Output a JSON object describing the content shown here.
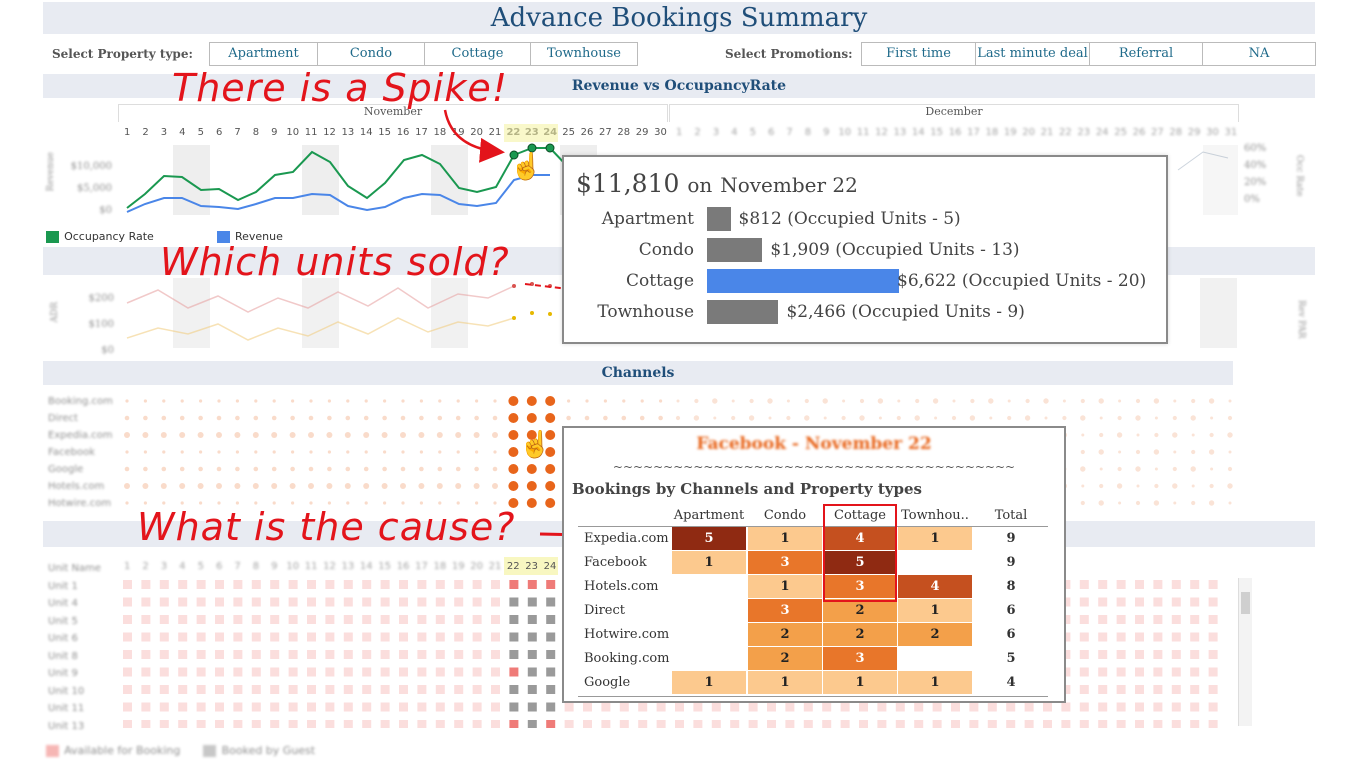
{
  "title": "Advance Bookings Summary",
  "filters": {
    "property_label": "Select Property type:",
    "property_options": [
      "Apartment",
      "Condo",
      "Cottage",
      "Townhouse"
    ],
    "promotion_label": "Select Promotions:",
    "promotion_options": [
      "First time",
      "Last minute deal",
      "Referral",
      "NA"
    ]
  },
  "sections": {
    "revenue_title": "Revenue vs OccupancyRate",
    "channels_title": "Channels"
  },
  "months": {
    "first": "November",
    "second": "December"
  },
  "nov_days": [
    "1",
    "2",
    "3",
    "4",
    "5",
    "6",
    "7",
    "8",
    "9",
    "10",
    "11",
    "12",
    "13",
    "14",
    "15",
    "16",
    "17",
    "18",
    "19",
    "20",
    "21",
    "22",
    "23",
    "24",
    "25",
    "26",
    "27",
    "28",
    "29",
    "30"
  ],
  "dec_days": [
    "1",
    "2",
    "3",
    "4",
    "5",
    "6",
    "7",
    "8",
    "9",
    "10",
    "11",
    "12",
    "13",
    "14",
    "15",
    "16",
    "17",
    "18",
    "19",
    "20",
    "21",
    "22",
    "23",
    "24",
    "25",
    "26",
    "27",
    "28",
    "29",
    "30",
    "31"
  ],
  "revenue_axis": [
    "$10,000",
    "$5,000",
    "$0"
  ],
  "occ_axis": [
    "60%",
    "40%",
    "20%",
    "0%"
  ],
  "occ_axis_title": "Occ Rate",
  "revenue_axis_title": "Revenue",
  "adr_axis": [
    "$200",
    "$100",
    "$0"
  ],
  "adr_axis_title": "ADR",
  "rev_par_axis_title": "Rev PAR",
  "legend_top": {
    "occupancy": "Occupancy Rate",
    "revenue": "Revenue",
    "occupancy_color": "#1a9850",
    "revenue_color": "#4a86e8"
  },
  "callouts": {
    "spike": "There is a Spike!",
    "units": "Which units sold?",
    "cause": "What is the cause?"
  },
  "tooltip": {
    "amount": "$11,810",
    "on": "on",
    "date": "November  22",
    "rows": [
      {
        "label": "Apartment",
        "value": "$812 (Occupied Units - 5)",
        "amount": 812,
        "color": "#7a7a7a"
      },
      {
        "label": "Condo",
        "value": "$1,909 (Occupied Units - 13)",
        "amount": 1909,
        "color": "#7a7a7a"
      },
      {
        "label": "Cottage",
        "value": "$6,622 (Occupied Units - 20)",
        "amount": 6622,
        "color": "#4a86e8"
      },
      {
        "label": "Townhouse",
        "value": "$2,466 (Occupied Units - 9)",
        "amount": 2466,
        "color": "#7a7a7a"
      }
    ]
  },
  "channels": [
    "Booking.com",
    "Direct",
    "Expedia.com",
    "Facebook",
    "Google",
    "Hotels.com",
    "Hotwire.com"
  ],
  "table_popup": {
    "title": "Facebook - November  22",
    "tilde": "~~~~~~~~~~~~~~~~~~~~~~~~~~~~~~~~~~~~~~~~",
    "subtitle": "Bookings by Channels and Property types",
    "columns": [
      "Apartment",
      "Condo",
      "Cottage",
      "Townhou..",
      "Total"
    ],
    "rows": [
      {
        "label": "Expedia.com",
        "cells": [
          "5",
          "1",
          "4",
          "1"
        ],
        "total": "9"
      },
      {
        "label": "Facebook",
        "cells": [
          "1",
          "3",
          "5",
          ""
        ],
        "total": "9"
      },
      {
        "label": "Hotels.com",
        "cells": [
          "",
          "1",
          "3",
          "4"
        ],
        "total": "8"
      },
      {
        "label": "Direct",
        "cells": [
          "",
          "3",
          "2",
          "1"
        ],
        "total": "6"
      },
      {
        "label": "Hotwire.com",
        "cells": [
          "",
          "2",
          "2",
          "2"
        ],
        "total": "6"
      },
      {
        "label": "Booking.com",
        "cells": [
          "",
          "2",
          "3",
          ""
        ],
        "total": "5"
      },
      {
        "label": "Google",
        "cells": [
          "1",
          "1",
          "1",
          "1"
        ],
        "total": "4"
      }
    ]
  },
  "units": {
    "header": "Unit Name",
    "names": [
      "Unit 1",
      "Unit 4",
      "Unit 5",
      "Unit 6",
      "Unit 8",
      "Unit 9",
      "Unit 10",
      "Unit 11",
      "Unit 13"
    ]
  },
  "legend_bottom": {
    "available": "Available for Booking",
    "booked": "Booked by Guest",
    "available_color": "#ef7b78",
    "booked_color": "#9a9a9a"
  }
}
